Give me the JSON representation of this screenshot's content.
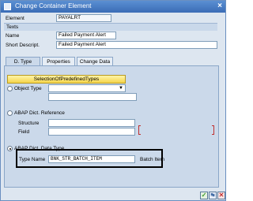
{
  "window": {
    "title": "Change Container Element",
    "close": "×"
  },
  "header": {
    "element_label": "Element",
    "element_value": "PAYALRT"
  },
  "texts": {
    "section_title": "Texts",
    "name_label": "Name",
    "name_value": "Failed Payment Alert",
    "short_label": "Short Descript.",
    "short_value": "Failed Payment Alert"
  },
  "tabs": [
    {
      "label": "D. Type",
      "active": true
    },
    {
      "label": "Properties",
      "active": false
    },
    {
      "label": "Change Data",
      "active": false
    }
  ],
  "dtype": {
    "predefined_button": "SelectionOfPredefinedTypes",
    "object_type_label": "Object Type",
    "dict_ref_label": "ABAP Dict. Reference",
    "structure_label": "Structure",
    "field_label": "Field",
    "data_type_label": "ABAP Dict. Data Type",
    "type_name_label": "Type Name",
    "type_name_value": "BNK_STR_BATCH_ITEM",
    "type_desc": "Batch Item"
  },
  "colors": {
    "accent_title": "#3a6cb6",
    "ok_green": "#3a9a2a",
    "cancel_red": "#c03030"
  }
}
